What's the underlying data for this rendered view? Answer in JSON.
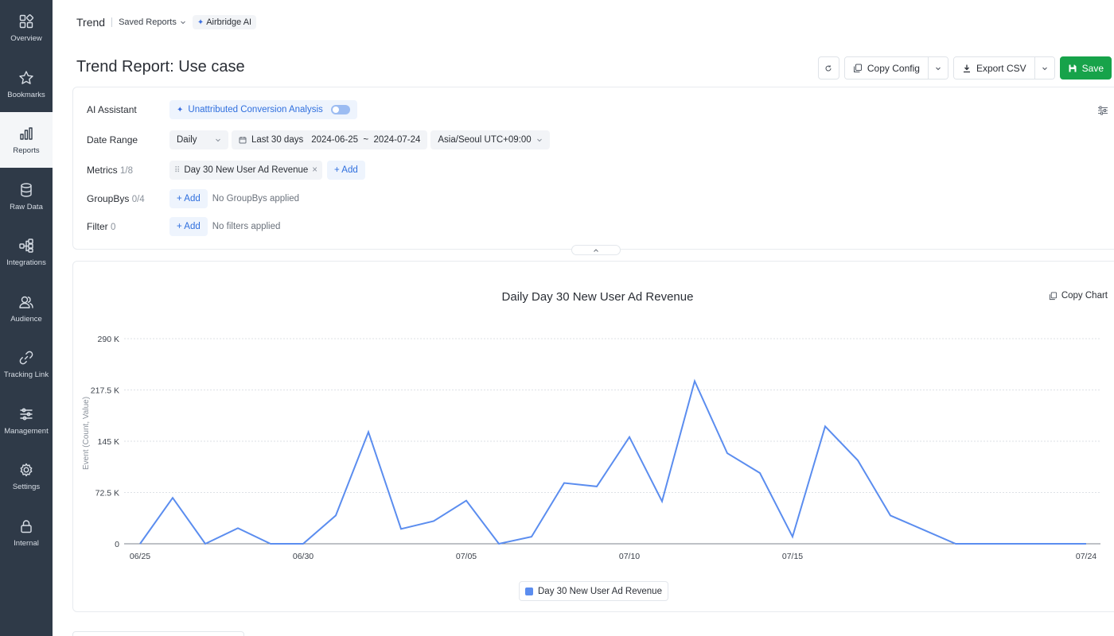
{
  "sidebar": {
    "items": [
      {
        "label": "Overview",
        "icon": "overview-icon"
      },
      {
        "label": "Bookmarks",
        "icon": "star-icon"
      },
      {
        "label": "Reports",
        "icon": "bar-chart-icon",
        "active": true
      },
      {
        "label": "Raw Data",
        "icon": "database-icon"
      },
      {
        "label": "Integrations",
        "icon": "integrations-icon"
      },
      {
        "label": "Audience",
        "icon": "users-icon"
      },
      {
        "label": "Tracking Link",
        "icon": "link-icon"
      },
      {
        "label": "Management",
        "icon": "sliders-icon"
      },
      {
        "label": "Settings",
        "icon": "gear-icon"
      },
      {
        "label": "Internal",
        "icon": "lock-icon"
      }
    ]
  },
  "topbar": {
    "trend": "Trend",
    "saved_reports": "Saved Reports",
    "ai": "Airbridge AI"
  },
  "page": {
    "title": "Trend Report: Use case"
  },
  "actions": {
    "copy_config": "Copy Config",
    "export_csv": "Export CSV",
    "save": "Save"
  },
  "config": {
    "ai_assistant": {
      "label": "AI Assistant",
      "value": "Unattributed Conversion Analysis"
    },
    "date_range": {
      "label": "Date Range",
      "granularity": "Daily",
      "preset": "Last 30 days",
      "range": "2024-06-25  ~  2024-07-24",
      "timezone": "Asia/Seoul UTC+09:00"
    },
    "metrics": {
      "label": "Metrics",
      "count": "1/8",
      "chip": "Day 30 New User Ad Revenue",
      "add": "+ Add"
    },
    "groupbys": {
      "label": "GroupBys",
      "count": "0/4",
      "add": "+ Add",
      "empty": "No GroupBys applied"
    },
    "filter": {
      "label": "Filter",
      "count": "0",
      "add": "+ Add",
      "empty": "No filters applied"
    }
  },
  "chart_panel": {
    "copy_chart": "Copy Chart"
  },
  "chart_data": {
    "type": "line",
    "title": "Daily Day 30 New User Ad Revenue",
    "xlabel": "",
    "ylabel": "Event (Count, Value)",
    "ylim": [
      0,
      290000
    ],
    "ytick_labels": [
      "0",
      "72.5 K",
      "145 K",
      "217.5 K",
      "290 K"
    ],
    "ytick_values": [
      0,
      72500,
      145000,
      217500,
      290000
    ],
    "x": [
      "06/25",
      "06/26",
      "06/27",
      "06/28",
      "06/29",
      "06/30",
      "07/01",
      "07/02",
      "07/03",
      "07/04",
      "07/05",
      "07/06",
      "07/07",
      "07/08",
      "07/09",
      "07/10",
      "07/11",
      "07/12",
      "07/13",
      "07/14",
      "07/15",
      "07/16",
      "07/17",
      "07/18",
      "07/19",
      "07/20",
      "07/21",
      "07/22",
      "07/23",
      "07/24"
    ],
    "xtick_labels": [
      "06/25",
      "06/30",
      "07/05",
      "07/10",
      "07/15",
      "07/24"
    ],
    "grid": true,
    "legend": "bottom-center",
    "color": "#5b8def",
    "series": [
      {
        "name": "Day 30 New User Ad Revenue",
        "values": [
          0,
          65000,
          0,
          22000,
          0,
          0,
          40000,
          158000,
          21000,
          32000,
          61000,
          0,
          10000,
          86000,
          81000,
          151000,
          60000,
          230000,
          128000,
          100000,
          10000,
          166000,
          118000,
          40000,
          20000,
          0,
          0,
          0,
          0,
          0
        ]
      }
    ]
  }
}
